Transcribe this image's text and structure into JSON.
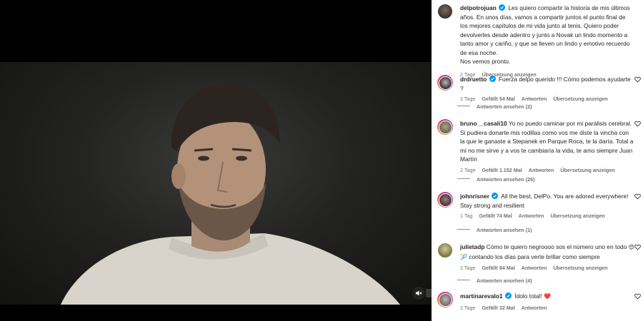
{
  "caption": {
    "username": "delpotrojuan",
    "text": "Les quiero compartir la historia de mis últimos años. En unos días, vamos a compartir juntos el punto final de los mejores capítulos de mi vida junto al tenis. Quiero poder devolverles desde adentro y junto a Novak un lindo momento a tanto amor y cariño, y que se lleven un lindo y emotivo recuerdo de esa noche.",
    "text2": "Nos vemos pronto.",
    "time": "2 Tage",
    "translate": "Übersetzung anzeigen"
  },
  "comments": [
    {
      "username": "drdruetto",
      "verified": true,
      "text": "Fuerza delpo querido !!! Cómo podemos ayudarte ?",
      "time": "2 Tage",
      "likes": "Gefällt 54 Mal",
      "reply": "Antworten",
      "translate": "Übersetzung anzeigen",
      "replies": "Antworten ansehen (2)"
    },
    {
      "username": "bruno__casali10",
      "verified": false,
      "text": "Yo no puedo caminar por mi parálisis cerebral. Si pudiera donarte mis rodillas como vos me diste la vincha con la que le ganaste a Stepanek en Parque Roca, te la daría. Total a mi no me sirve y a vos te cambiaría la vida, te amo siempre Juan Martín",
      "time": "2 Tage",
      "likes": "Gefällt 1.152 Mal",
      "reply": "Antworten",
      "translate": "Übersetzung anzeigen",
      "replies": "Antworten ansehen (26)"
    },
    {
      "username": "johnrisner",
      "verified": true,
      "text": "All the best, DelPo. You are adored everywhere! Stay strong and resilient",
      "time": "1 Tag",
      "likes": "Gefällt 74 Mal",
      "reply": "Antworten",
      "translate": "Übersetzung anzeigen",
      "replies": "Antworten ansehen (1)"
    },
    {
      "username": "julietadp",
      "verified": false,
      "text": "Cómo te quiero negroooo sos el número uno en todo",
      "text_after": "contando los días para verte brillar como siempre",
      "emoji": "😍 🎾",
      "time": "2 Tage",
      "likes": "Gefällt 84 Mal",
      "reply": "Antworten",
      "translate": "Übersetzung anzeigen",
      "replies": "Antworten ansehen (4)"
    },
    {
      "username": "martinarevalo1",
      "verified": true,
      "text": "Ídolo total!",
      "emoji": "❤️",
      "time": "2 Tage",
      "likes": "Gefällt 32 Mal",
      "reply": "Antworten"
    }
  ],
  "icons": {
    "verified": "verified-badge-icon",
    "like": "heart-icon",
    "mute": "speaker-muted-icon"
  },
  "colors": {
    "verified_blue": "#0095f6",
    "meta_gray": "#737373",
    "text": "#262626",
    "emoji_heart": "#e0245e"
  }
}
